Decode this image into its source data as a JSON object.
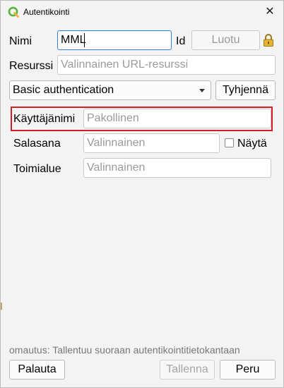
{
  "window": {
    "title": "Autentikointi",
    "close_symbol": "✕"
  },
  "form": {
    "name_label": "Nimi",
    "name_value": "MML",
    "id_label": "Id",
    "id_placeholder": "Luotu",
    "resource_label": "Resurssi",
    "resource_placeholder": "Valinnainen URL-resurssi",
    "method_selected": "Basic authentication",
    "clear_button": "Tyhjennä"
  },
  "basic_auth": {
    "username_label": "Käyttäjänimi",
    "username_placeholder": "Pakollinen",
    "password_label": "Salasana",
    "password_placeholder": "Valinnainen",
    "show_label": "Näytä",
    "show_checked": false,
    "realm_label": "Toimialue",
    "realm_placeholder": "Valinnainen"
  },
  "status": {
    "message": "omautus: Tallentuu suoraan autentikointitietokantaan"
  },
  "buttons": {
    "reset": "Palauta",
    "save": "Tallenna",
    "cancel": "Peru"
  },
  "icons": {
    "app": "qgis-logo-icon",
    "lock": "lock-icon",
    "close": "close-icon",
    "dropdown": "chevron-down-icon"
  },
  "colors": {
    "highlight": "#d11f2a",
    "focus": "#3a7ed8",
    "lock": "#e8b32e",
    "qgis_green": "#59b342"
  }
}
